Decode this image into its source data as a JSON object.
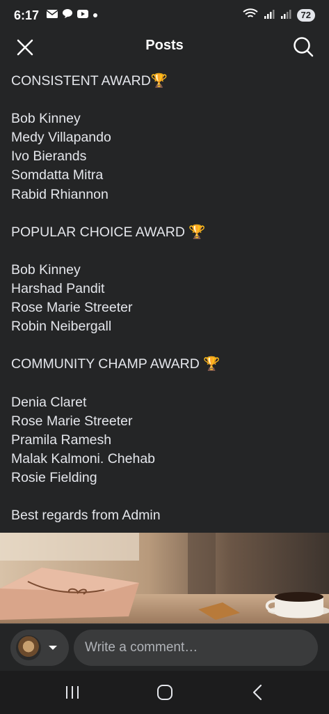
{
  "status_bar": {
    "time": "6:17",
    "battery": "72",
    "left_icons": [
      "mail-icon",
      "chat-icon",
      "youtube-icon",
      "dot-icon"
    ],
    "right_icons": [
      "wifi-icon",
      "signal-icon",
      "signal-icon-2",
      "battery-icon"
    ]
  },
  "header": {
    "title": "Posts",
    "close_icon": "close-icon",
    "search_icon": "search-icon"
  },
  "post": {
    "lines": [
      "CONSISTENT AWARD🏆",
      "",
      "Bob Kinney",
      "Medy Villapando",
      "Ivo Bierands",
      "Somdatta Mitra",
      "Rabid Rhiannon",
      "",
      "POPULAR CHOICE AWARD 🏆",
      "",
      "Bob Kinney",
      "Harshad Pandit",
      "Rose Marie Streeter",
      "Robin Neibergall",
      "",
      "COMMUNITY CHAMP AWARD 🏆",
      "",
      "Denia Claret",
      "Rose Marie Streeter",
      "Pramila Ramesh",
      "Malak Kalmoni. Chehab",
      "Rosie Fielding",
      "",
      "Best regards from Admin"
    ]
  },
  "comment_bar": {
    "placeholder": "Write a comment…",
    "avatar_icon": "avatar",
    "dropdown_icon": "caret-down-icon"
  },
  "nav_bar": {
    "recent_icon": "recent-apps-icon",
    "home_icon": "home-icon",
    "back_icon": "back-icon"
  },
  "colors": {
    "background": "#242526",
    "text": "#e4e6eb",
    "input_bg": "#3a3b3c",
    "placeholder": "#b0b3b8",
    "nav_bg": "#1c1c1d"
  }
}
